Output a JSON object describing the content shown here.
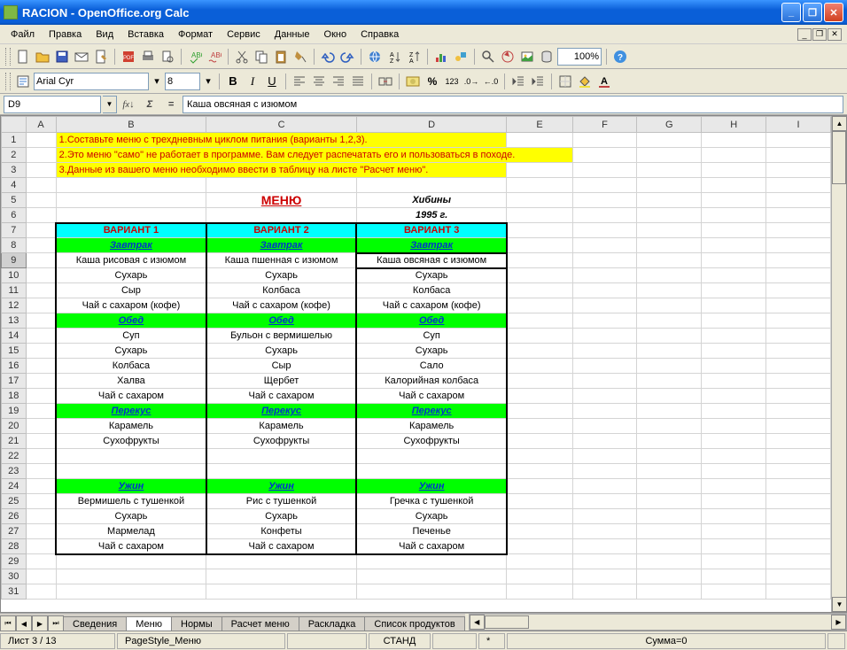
{
  "window": {
    "title": "RACION - OpenOffice.org Calc"
  },
  "menubar": [
    "Файл",
    "Правка",
    "Вид",
    "Вставка",
    "Формат",
    "Сервис",
    "Данные",
    "Окно",
    "Справка"
  ],
  "font": {
    "name": "Arial Cyr",
    "size": "8"
  },
  "zoom": "100%",
  "cellref": "D9",
  "formula": "Каша овсяная с изюмом",
  "columns": [
    "A",
    "B",
    "C",
    "D",
    "E",
    "F",
    "G",
    "H",
    "I"
  ],
  "instructions": [
    "1.Составьте меню с трехдневным циклом питания (варианты 1,2,3).",
    "2.Это меню \"само\" не работает в программе. Вам следует распечатать его и пользоваться в походе.",
    "3.Данные из вашего меню необходимо ввести в таблицу на листе \"Расчет меню\"."
  ],
  "menu_title": "МЕНЮ",
  "location": "Хибины",
  "year": "1995 г.",
  "variants": [
    "ВАРИАНТ 1",
    "ВАРИАНТ 2",
    "ВАРИАНТ 3"
  ],
  "meals": {
    "breakfast": "Завтрак",
    "lunch": "Обед",
    "snack": "Перекус",
    "dinner": "Ужин"
  },
  "rows": [
    {
      "n": 9,
      "type": "data",
      "b": "Каша рисовая с изюмом",
      "c": "Каша пшенная с изюмом",
      "d": "Каша овсяная с изюмом"
    },
    {
      "n": 10,
      "type": "data",
      "b": "Сухарь",
      "c": "Сухарь",
      "d": "Сухарь"
    },
    {
      "n": 11,
      "type": "data",
      "b": "Сыр",
      "c": "Колбаса",
      "d": "Колбаса"
    },
    {
      "n": 12,
      "type": "data",
      "b": "Чай с сахаром (кофе)",
      "c": "Чай с сахаром (кофе)",
      "d": "Чай с сахаром (кофе)"
    },
    {
      "n": 14,
      "type": "data",
      "b": "Суп",
      "c": "Бульон с вермишелью",
      "d": "Суп"
    },
    {
      "n": 15,
      "type": "data",
      "b": "Сухарь",
      "c": "Сухарь",
      "d": "Сухарь"
    },
    {
      "n": 16,
      "type": "data",
      "b": "Колбаса",
      "c": "Сыр",
      "d": "Сало"
    },
    {
      "n": 17,
      "type": "data",
      "b": "Халва",
      "c": "Щербет",
      "d": "Калорийная колбаса"
    },
    {
      "n": 18,
      "type": "data",
      "b": "Чай с сахаром",
      "c": "Чай с сахаром",
      "d": "Чай с сахаром"
    },
    {
      "n": 20,
      "type": "data",
      "b": "Карамель",
      "c": "Карамель",
      "d": "Карамель"
    },
    {
      "n": 21,
      "type": "data",
      "b": "Сухофрукты",
      "c": "Сухофрукты",
      "d": "Сухофрукты"
    },
    {
      "n": 25,
      "type": "data",
      "b": "Вермишель с тушенкой",
      "c": "Рис с тушенкой",
      "d": "Гречка с тушенкой"
    },
    {
      "n": 26,
      "type": "data",
      "b": "Сухарь",
      "c": "Сухарь",
      "d": "Сухарь"
    },
    {
      "n": 27,
      "type": "data",
      "b": "Мармелад",
      "c": "Конфеты",
      "d": "Печенье"
    },
    {
      "n": 28,
      "type": "data",
      "b": "Чай с сахаром",
      "c": "Чай с сахаром",
      "d": "Чай с сахаром"
    }
  ],
  "tabs": [
    "Сведения",
    "Меню",
    "Нормы",
    "Расчет меню",
    "Раскладка",
    "Список продуктов"
  ],
  "active_tab": 1,
  "status": {
    "sheet": "Лист 3 / 13",
    "pagestyle": "PageStyle_Меню",
    "mode": "СТАНД",
    "sum": "Сумма=0"
  }
}
